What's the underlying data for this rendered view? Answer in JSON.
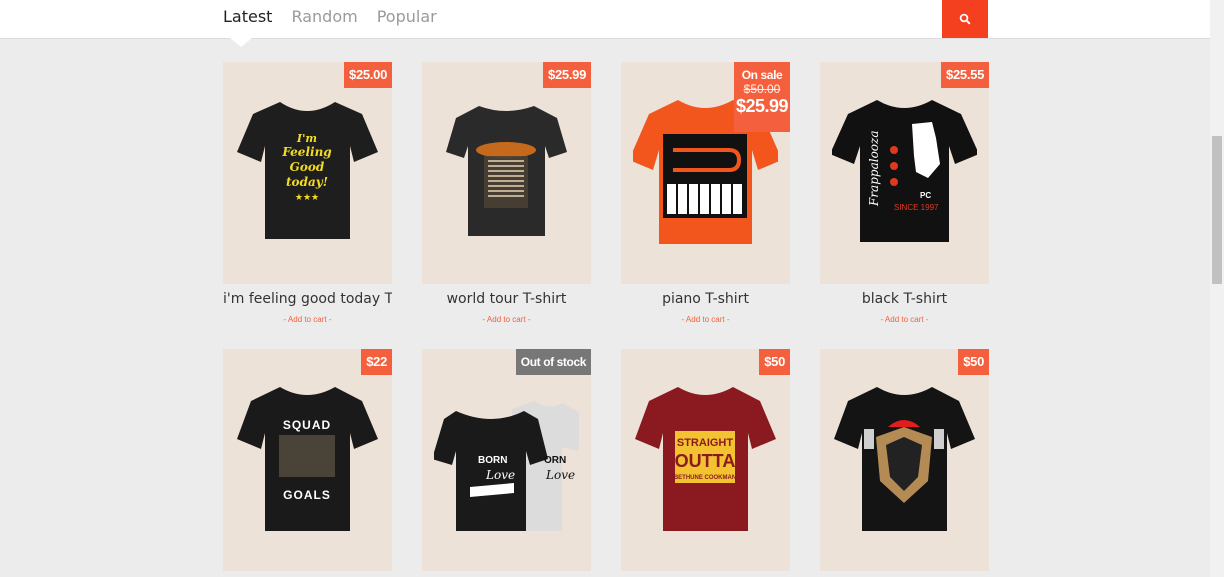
{
  "tabs": [
    "Latest",
    "Random",
    "Popular"
  ],
  "search_icon": "search-icon",
  "colors": {
    "accent": "#f4401e",
    "badge": "#f4603d",
    "out_of_stock": "#777777",
    "card_bg": "#ede2d8"
  },
  "products": [
    {
      "title": "i'm feeling good today T-",
      "price": "$25.00",
      "cart": "- Add to cart -",
      "shirt_color": "#1e1e1e",
      "print": "I'm Feeling Good today!"
    },
    {
      "title": "world tour T-shirt",
      "price": "$25.99",
      "cart": "- Add to cart -",
      "shirt_color": "#2a2a2a",
      "print": ""
    },
    {
      "title": "piano T-shirt",
      "sale_label": "On sale",
      "old_price": "$50.00",
      "price": "$25.99",
      "cart": "- Add to cart -",
      "shirt_color": "#f2561c",
      "print": ""
    },
    {
      "title": "black T-shirt",
      "price": "$25.55",
      "cart": "- Add to cart -",
      "shirt_color": "#111111",
      "print": "Frappalooza"
    },
    {
      "price": "$22",
      "shirt_color": "#1a1a1a",
      "print": "SQUAD GOALS"
    },
    {
      "oos": "Out of stock",
      "shirt_color": "#1a1a1a",
      "print": "BORN Love"
    },
    {
      "price": "$50",
      "shirt_color": "#8a1a1f",
      "print": "STRAIGHT OUTTA"
    },
    {
      "price": "$50",
      "shirt_color": "#141414",
      "print": ""
    }
  ]
}
